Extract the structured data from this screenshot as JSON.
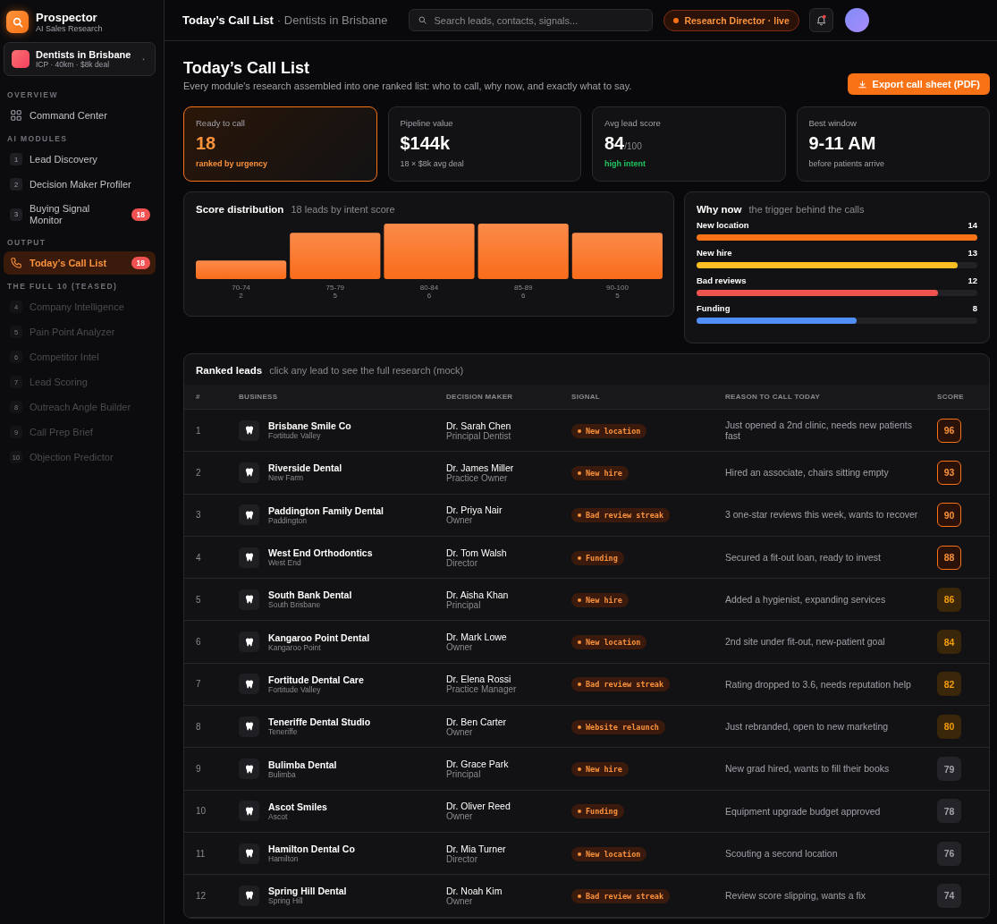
{
  "brand": {
    "name": "Prospector",
    "tagline": "AI Sales Research"
  },
  "workspace": {
    "title": "Dentists in Brisbane",
    "subtitle": "ICP · 40km · $8k deal"
  },
  "sidebar": {
    "sections": [
      {
        "label": "OVERVIEW",
        "items": [
          {
            "kind": "link",
            "label": "Command Center",
            "selected": false,
            "disabled": false
          }
        ]
      },
      {
        "label": "AI MODULES",
        "items": [
          {
            "kind": "module",
            "number": "1",
            "label": "Lead Discovery",
            "selected": false,
            "disabled": false
          },
          {
            "kind": "module",
            "number": "2",
            "label": "Decision Maker Profiler",
            "selected": false,
            "disabled": false
          },
          {
            "kind": "module",
            "number": "3",
            "label": "Buying Signal Monitor",
            "badge": "18",
            "selected": false,
            "disabled": false
          }
        ]
      },
      {
        "label": "OUTPUT",
        "items": [
          {
            "kind": "call",
            "label": "Today’s Call List",
            "badge": "18",
            "selected": true,
            "disabled": false
          }
        ]
      },
      {
        "label": "THE FULL 10 (TEASED)",
        "items": [
          {
            "kind": "module",
            "number": "4",
            "label": "Company Intelligence",
            "selected": false,
            "disabled": true
          },
          {
            "kind": "module",
            "number": "5",
            "label": "Pain Point Analyzer",
            "selected": false,
            "disabled": true
          },
          {
            "kind": "module",
            "number": "6",
            "label": "Competitor Intel",
            "selected": false,
            "disabled": true
          },
          {
            "kind": "module",
            "number": "7",
            "label": "Lead Scoring",
            "selected": false,
            "disabled": true
          },
          {
            "kind": "module",
            "number": "8",
            "label": "Outreach Angle Builder",
            "selected": false,
            "disabled": true
          },
          {
            "kind": "module",
            "number": "9",
            "label": "Call Prep Brief",
            "selected": false,
            "disabled": true
          },
          {
            "kind": "module",
            "number": "10",
            "label": "Objection Predictor",
            "selected": false,
            "disabled": true
          }
        ]
      }
    ]
  },
  "topbar": {
    "title": "Today’s Call List",
    "context": "· Dentists in Brisbane",
    "search": {
      "placeholder": "Search leads, contacts, signals..."
    },
    "status": "Research Director · live",
    "notifications": true
  },
  "page": {
    "title": "Today’s Call List",
    "subtitle": "Every module's research assembled into one ranked list: who to call, why now, and exactly what to say.",
    "export_button": "Export call sheet (PDF)"
  },
  "kpis": [
    {
      "label": "Ready to call",
      "value": "18",
      "note": "ranked by urgency",
      "kind": "highlight"
    },
    {
      "label": "Pipeline value",
      "value": "$144k",
      "note": "18 × $8k avg deal",
      "kind": "plain"
    },
    {
      "label": "Avg lead score",
      "value": "84",
      "unit": "/100",
      "note": "high intent",
      "kind": "good"
    },
    {
      "label": "Best window",
      "value": "9-11 AM",
      "note": "before patients arrive",
      "kind": "plain"
    }
  ],
  "score_distribution": {
    "title": "Score distribution",
    "subtitle": "18 leads by intent score",
    "chart_data": {
      "type": "bar",
      "categories": [
        "70-74",
        "75-79",
        "80-84",
        "85-89",
        "90-100"
      ],
      "values": [
        2,
        5,
        6,
        6,
        5
      ],
      "data_labels": true
    }
  },
  "why_now": {
    "title": "Why now",
    "subtitle": "the trigger behind the calls",
    "items": [
      {
        "label": "New location",
        "count": "14",
        "level": 1.0,
        "color": "#f97316"
      },
      {
        "label": "New hire",
        "count": "13",
        "level": 0.93,
        "color": "#fbbf24"
      },
      {
        "label": "Bad reviews",
        "count": "12",
        "level": 0.86,
        "color": "#ef5350"
      },
      {
        "label": "Funding",
        "count": "8",
        "level": 0.57,
        "color": "#4f8ff7"
      }
    ]
  },
  "leads": {
    "title": "Ranked leads",
    "subtitle": "click any lead to see the full research (mock)",
    "columns": [
      "#",
      "BUSINESS",
      "DECISION MAKER",
      "SIGNAL",
      "REASON TO CALL TODAY",
      "SCORE"
    ],
    "rows": [
      {
        "rank": "1",
        "business": "Brisbane Smile Co",
        "suburb": "Fortitude Valley",
        "contact": "Dr. Sarah Chen",
        "role": "Principal Dentist",
        "signal": "New location",
        "reason": "Just opened a 2nd clinic, needs new patients fast",
        "score": "96",
        "kind": "hot"
      },
      {
        "rank": "2",
        "business": "Riverside Dental",
        "suburb": "New Farm",
        "contact": "Dr. James Miller",
        "role": "Practice Owner",
        "signal": "New hire",
        "reason": "Hired an associate, chairs sitting empty",
        "score": "93",
        "kind": "hot"
      },
      {
        "rank": "3",
        "business": "Paddington Family Dental",
        "suburb": "Paddington",
        "contact": "Dr. Priya Nair",
        "role": "Owner",
        "signal": "Bad review streak",
        "reason": "3 one-star reviews this week, wants to recover",
        "score": "90",
        "kind": "hot"
      },
      {
        "rank": "4",
        "business": "West End Orthodontics",
        "suburb": "West End",
        "contact": "Dr. Tom Walsh",
        "role": "Director",
        "signal": "Funding",
        "reason": "Secured a fit-out loan, ready to invest",
        "score": "88",
        "kind": "hot"
      },
      {
        "rank": "5",
        "business": "South Bank Dental",
        "suburb": "South Brisbane",
        "contact": "Dr. Aisha Khan",
        "role": "Principal",
        "signal": "New hire",
        "reason": "Added a hygienist, expanding services",
        "score": "86",
        "kind": "warm"
      },
      {
        "rank": "6",
        "business": "Kangaroo Point Dental",
        "suburb": "Kangaroo Point",
        "contact": "Dr. Mark Lowe",
        "role": "Owner",
        "signal": "New location",
        "reason": "2nd site under fit-out, new-patient goal",
        "score": "84",
        "kind": "warm"
      },
      {
        "rank": "7",
        "business": "Fortitude Dental Care",
        "suburb": "Fortitude Valley",
        "contact": "Dr. Elena Rossi",
        "role": "Practice Manager",
        "signal": "Bad review streak",
        "reason": "Rating dropped to 3.6, needs reputation help",
        "score": "82",
        "kind": "warm"
      },
      {
        "rank": "8",
        "business": "Teneriffe Dental Studio",
        "suburb": "Teneriffe",
        "contact": "Dr. Ben Carter",
        "role": "Owner",
        "signal": "Website relaunch",
        "reason": "Just rebranded, open to new marketing",
        "score": "80",
        "kind": "warm"
      },
      {
        "rank": "9",
        "business": "Bulimba Dental",
        "suburb": "Bulimba",
        "contact": "Dr. Grace Park",
        "role": "Principal",
        "signal": "New hire",
        "reason": "New grad hired, wants to fill their books",
        "score": "79",
        "kind": "cool"
      },
      {
        "rank": "10",
        "business": "Ascot Smiles",
        "suburb": "Ascot",
        "contact": "Dr. Oliver Reed",
        "role": "Owner",
        "signal": "Funding",
        "reason": "Equipment upgrade budget approved",
        "score": "78",
        "kind": "cool"
      },
      {
        "rank": "11",
        "business": "Hamilton Dental Co",
        "suburb": "Hamilton",
        "contact": "Dr. Mia Turner",
        "role": "Director",
        "signal": "New location",
        "reason": "Scouting a second location",
        "score": "76",
        "kind": "cool"
      },
      {
        "rank": "12",
        "business": "Spring Hill Dental",
        "suburb": "Spring Hill",
        "contact": "Dr. Noah Kim",
        "role": "Owner",
        "signal": "Bad review streak",
        "reason": "Review score slipping, wants a fix",
        "score": "74",
        "kind": "cool"
      }
    ]
  }
}
